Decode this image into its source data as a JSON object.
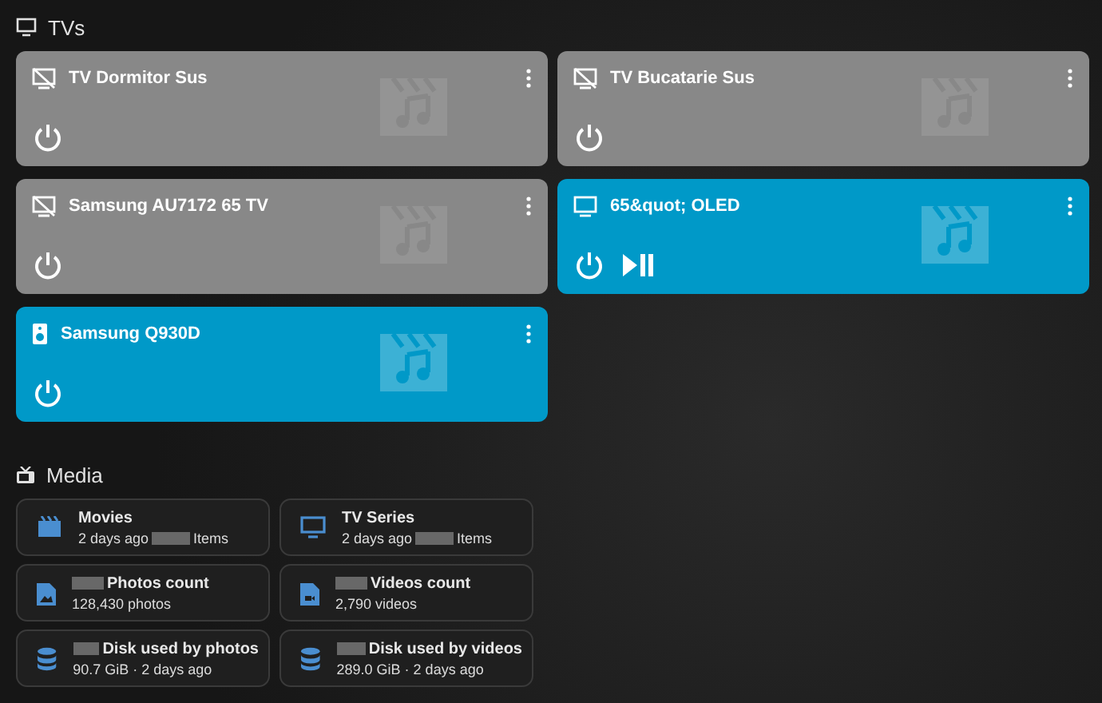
{
  "tvs": {
    "title": "TVs",
    "cards": [
      {
        "name": "TV Dormitor Sus",
        "on": false,
        "kind": "tv-off",
        "controls": [
          {
            "kind": "power"
          }
        ]
      },
      {
        "name": "TV Bucatarie Sus",
        "on": false,
        "kind": "tv-off",
        "controls": [
          {
            "kind": "power"
          }
        ]
      },
      {
        "name": "Samsung AU7172 65 TV",
        "on": false,
        "kind": "tv-off",
        "controls": [
          {
            "kind": "power"
          }
        ]
      },
      {
        "name": "65&quot; OLED",
        "on": true,
        "kind": "tv",
        "controls": [
          {
            "kind": "power"
          },
          {
            "kind": "play-pause"
          }
        ]
      },
      {
        "name": "Samsung Q930D",
        "on": true,
        "kind": "speaker",
        "controls": [
          {
            "kind": "power"
          }
        ]
      }
    ]
  },
  "media": {
    "title": "Media",
    "tiles": [
      {
        "kind": "clapper",
        "title": "Movies",
        "redacted_title": false,
        "subtitle": "2 days ago",
        "redacted_count": true,
        "suffix": "Items"
      },
      {
        "kind": "monitor",
        "title": "TV Series",
        "redacted_title": false,
        "subtitle": "2 days ago",
        "redacted_count": true,
        "suffix": "Items"
      },
      {
        "kind": "image-file",
        "title": "Photos count",
        "redacted_title": true,
        "subtitle": "128,430 photos",
        "redacted_count": false
      },
      {
        "kind": "video-file",
        "title": "Videos count",
        "redacted_title": true,
        "subtitle": "2,790 videos",
        "redacted_count": false
      },
      {
        "kind": "database",
        "title": "Disk used by photos",
        "redacted_title": true,
        "subtitle": "90.7 GiB · 2 days ago",
        "redacted_count": false
      },
      {
        "kind": "database",
        "title": "Disk used by videos",
        "redacted_title": true,
        "subtitle": "289.0 GiB · 2 days ago",
        "redacted_count": false
      }
    ]
  }
}
